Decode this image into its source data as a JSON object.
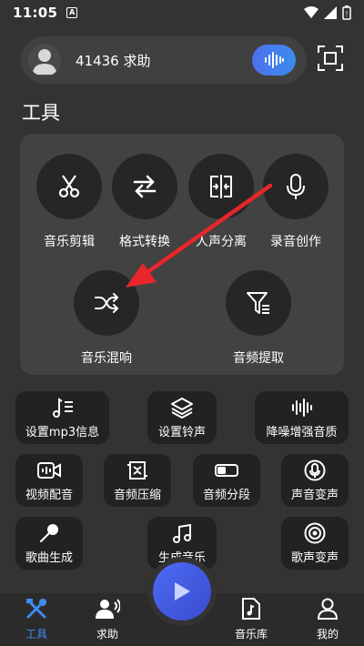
{
  "status": {
    "time": "11:05",
    "indicator": "A"
  },
  "profile": {
    "name": "41436 求助"
  },
  "section_title": "工具",
  "tools_main": [
    {
      "label": "音乐剪辑",
      "icon": "scissors-icon"
    },
    {
      "label": "格式转换",
      "icon": "swap-icon"
    },
    {
      "label": "人声分离",
      "icon": "split-icon"
    },
    {
      "label": "录音创作",
      "icon": "mic-icon"
    },
    {
      "label": "音乐混响",
      "icon": "shuffle-icon"
    },
    {
      "label": "音频提取",
      "icon": "filter-icon"
    }
  ],
  "tools_small": [
    {
      "label": "设置mp3信息",
      "icon": "note-list-icon"
    },
    {
      "label": "设置铃声",
      "icon": "layers-icon"
    },
    {
      "label": "降噪增强音质",
      "icon": "waveform-icon"
    },
    {
      "label": "视频配音",
      "icon": "video-icon"
    },
    {
      "label": "音频压缩",
      "icon": "compress-icon"
    },
    {
      "label": "音频分段",
      "icon": "segment-icon"
    },
    {
      "label": "声音变声",
      "icon": "voice-change-icon"
    },
    {
      "label": "歌曲生成",
      "icon": "microphone-icon"
    },
    {
      "label": "生成音乐",
      "icon": "music-note-icon"
    },
    {
      "label": "歌声变声",
      "icon": "disc-icon"
    }
  ],
  "nav": [
    {
      "label": "工具",
      "active": true
    },
    {
      "label": "求助",
      "active": false
    },
    {
      "label": "音乐库",
      "active": false
    },
    {
      "label": "我的",
      "active": false
    }
  ],
  "colors": {
    "accent": "#3d8cf0",
    "arrow": "#e8262b",
    "background": "#333333"
  }
}
